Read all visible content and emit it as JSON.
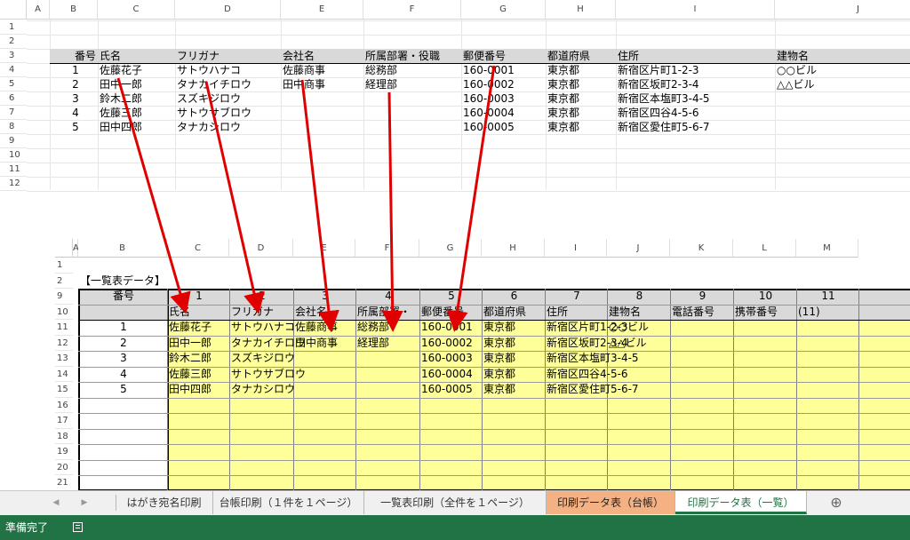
{
  "top_sheet": {
    "col_headers": [
      "A",
      "B",
      "C",
      "D",
      "E",
      "F",
      "G",
      "H",
      "I",
      "J"
    ],
    "row_numbers": [
      "1",
      "2",
      "3",
      "4",
      "5",
      "6",
      "7",
      "8",
      "9",
      "10",
      "11",
      "12"
    ],
    "headers": [
      "番号",
      "氏名",
      "フリガナ",
      "会社名",
      "所属部署・役職",
      "郵便番号",
      "都道府県",
      "住所",
      "建物名"
    ],
    "rows": [
      [
        "1",
        "佐藤花子",
        "サトウハナコ",
        "佐藤商事",
        "総務部",
        "160-0001",
        "東京都",
        "新宿区片町1-2-3",
        "○○ビル"
      ],
      [
        "2",
        "田中一郎",
        "タナカイチロウ",
        "田中商事",
        "経理部",
        "160-0002",
        "東京都",
        "新宿区坂町2-3-4",
        "△△ビル"
      ],
      [
        "3",
        "鈴木二郎",
        "スズキジロウ",
        "",
        "",
        "160-0003",
        "東京都",
        "新宿区本塩町3-4-5",
        ""
      ],
      [
        "4",
        "佐藤三郎",
        "サトウサブロウ",
        "",
        "",
        "160-0004",
        "東京都",
        "新宿区四谷4-5-6",
        ""
      ],
      [
        "5",
        "田中四郎",
        "タナカシロウ",
        "",
        "",
        "160-0005",
        "東京都",
        "新宿区愛住町5-6-7",
        ""
      ]
    ]
  },
  "bottom_sheet": {
    "col_headers": [
      "A",
      "B",
      "C",
      "D",
      "E",
      "F",
      "G",
      "H",
      "I",
      "J",
      "K",
      "L",
      "M"
    ],
    "row_numbers": [
      "1",
      "2",
      "9",
      "10",
      "11",
      "12",
      "13",
      "14",
      "15",
      "16",
      "17",
      "18",
      "19",
      "20",
      "21"
    ],
    "title": "【一覧表データ】",
    "index_label": "番号",
    "col_numbers": [
      "1",
      "2",
      "3",
      "4",
      "5",
      "6",
      "7",
      "8",
      "9",
      "10",
      "11"
    ],
    "field_labels": [
      "氏名",
      "フリガナ",
      "会社名",
      "所属部署・",
      "郵便番号",
      "都道府県",
      "住所",
      "建物名",
      "電話番号",
      "携帯番号",
      "(11)"
    ],
    "rows": [
      [
        "1",
        "佐藤花子",
        "サトウハナコ",
        "佐藤商事",
        "総務部",
        "160-0001",
        "東京都",
        "新宿区片町1-2-3",
        "○○ビル"
      ],
      [
        "2",
        "田中一郎",
        "タナカイチロウ",
        "田中商事",
        "経理部",
        "160-0002",
        "東京都",
        "新宿区坂町2-3-4",
        "△△ビル"
      ],
      [
        "3",
        "鈴木二郎",
        "スズキジロウ",
        "",
        "",
        "160-0003",
        "東京都",
        "新宿区本塩町3-4-5",
        ""
      ],
      [
        "4",
        "佐藤三郎",
        "サトウサブロウ",
        "",
        "",
        "160-0004",
        "東京都",
        "新宿区四谷4-5-6",
        ""
      ],
      [
        "5",
        "田中四郎",
        "タナカシロウ",
        "",
        "",
        "160-0005",
        "東京都",
        "新宿区愛住町5-6-7",
        ""
      ]
    ]
  },
  "tabs": [
    {
      "label": "はがき宛名印刷",
      "active": false
    },
    {
      "label": "台帳印刷（１件を１ページ）",
      "active": false
    },
    {
      "label": "一覧表印刷（全件を１ページ）",
      "active": false
    },
    {
      "label": "印刷データ表（台帳）",
      "active": false,
      "color": "#f4b183"
    },
    {
      "label": "印刷データ表（一覧）",
      "active": true
    }
  ],
  "nav": {
    "prev": "◀",
    "next": "▶",
    "add": "⊕"
  },
  "status": {
    "text": "準備完了"
  },
  "colors": {
    "arrow": "#e00000",
    "yellow": "#ffff99",
    "header_gray": "#d9d9d9",
    "status_green": "#217346"
  }
}
